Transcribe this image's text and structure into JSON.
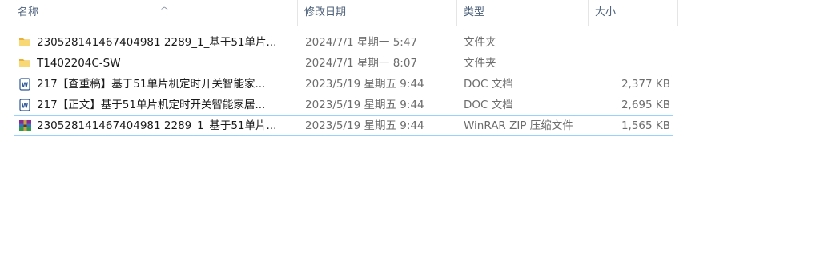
{
  "columns": {
    "name": "名称",
    "date": "修改日期",
    "type": "类型",
    "size": "大小"
  },
  "sort_indicator": "^",
  "files": [
    {
      "icon": "folder-icon",
      "name": "230528141467404981 2289_1_基于51单片...",
      "date": "2024/7/1 星期一 5:47",
      "type": "文件夹",
      "size": ""
    },
    {
      "icon": "folder-icon",
      "name": "T1402204C-SW",
      "date": "2024/7/1 星期一 8:07",
      "type": "文件夹",
      "size": ""
    },
    {
      "icon": "word-doc-icon",
      "name": "217【查重稿】基于51单片机定时开关智能家...",
      "date": "2023/5/19 星期五 9:44",
      "type": "DOC 文档",
      "size": "2,377 KB"
    },
    {
      "icon": "word-doc-icon",
      "name": "217【正文】基于51单片机定时开关智能家居...",
      "date": "2023/5/19 星期五 9:44",
      "type": "DOC 文档",
      "size": "2,695 KB"
    },
    {
      "icon": "winrar-archive-icon",
      "name": "230528141467404981 2289_1_基于51单片...",
      "date": "2023/5/19 星期五 9:44",
      "type": "WinRAR ZIP 压缩文件",
      "size": "1,565 KB"
    }
  ]
}
